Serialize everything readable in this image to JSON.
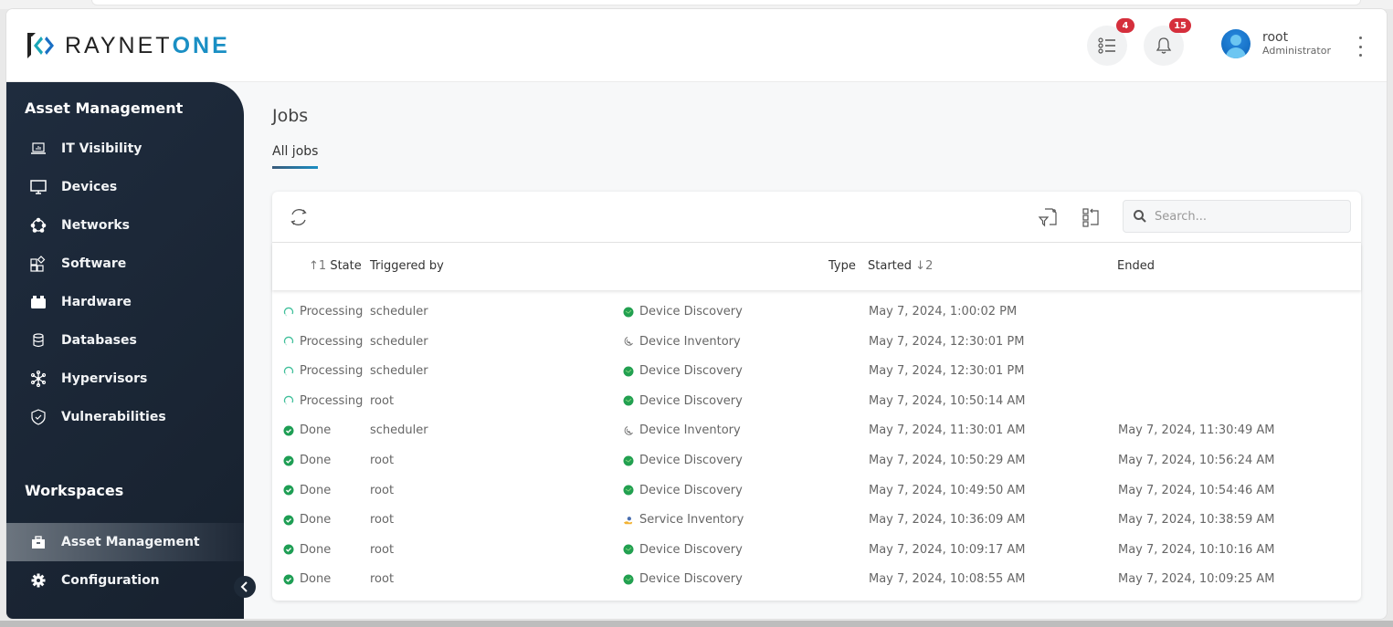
{
  "app": {
    "brand_left": "RAYNET",
    "brand_right": "ONE"
  },
  "header": {
    "tasks_badge": "4",
    "notifications_badge": "15",
    "user_name": "root",
    "user_role": "Administrator"
  },
  "sidebar": {
    "section_title": "Asset Management",
    "items": [
      {
        "label": "IT Visibility",
        "icon": "laptop-chart-icon"
      },
      {
        "label": "Devices",
        "icon": "monitor-icon"
      },
      {
        "label": "Networks",
        "icon": "network-icon"
      },
      {
        "label": "Software",
        "icon": "apps-icon"
      },
      {
        "label": "Hardware",
        "icon": "hardware-icon"
      },
      {
        "label": "Databases",
        "icon": "database-icon"
      },
      {
        "label": "Hypervisors",
        "icon": "hypervisor-icon"
      },
      {
        "label": "Vulnerabilities",
        "icon": "shield-check-icon"
      }
    ],
    "workspaces_title": "Workspaces",
    "workspaces": [
      {
        "label": "Asset Management",
        "icon": "briefcase-icon",
        "active": true
      },
      {
        "label": "Configuration",
        "icon": "gear-icon",
        "active": false
      }
    ]
  },
  "page": {
    "title": "Jobs",
    "tab_label": "All jobs"
  },
  "toolbar": {
    "search_placeholder": "Search..."
  },
  "table": {
    "columns": {
      "state_sort": "1",
      "state": "State",
      "triggered_by": "Triggered by",
      "type": "Type",
      "started": "Started",
      "started_sort": "2",
      "ended": "Ended"
    },
    "rows": [
      {
        "state": "Processing",
        "triggered_by": "scheduler",
        "type": "Device Discovery",
        "started": "May 7, 2024, 1:00:02 PM",
        "ended": ""
      },
      {
        "state": "Processing",
        "triggered_by": "scheduler",
        "type": "Device Inventory",
        "started": "May 7, 2024, 12:30:01 PM",
        "ended": ""
      },
      {
        "state": "Processing",
        "triggered_by": "scheduler",
        "type": "Device Discovery",
        "started": "May 7, 2024, 12:30:01 PM",
        "ended": ""
      },
      {
        "state": "Processing",
        "triggered_by": "root",
        "type": "Device Discovery",
        "started": "May 7, 2024, 10:50:14 AM",
        "ended": ""
      },
      {
        "state": "Done",
        "triggered_by": "scheduler",
        "type": "Device Inventory",
        "started": "May 7, 2024, 11:30:01 AM",
        "ended": "May 7, 2024, 11:30:49 AM"
      },
      {
        "state": "Done",
        "triggered_by": "root",
        "type": "Device Discovery",
        "started": "May 7, 2024, 10:50:29 AM",
        "ended": "May 7, 2024, 10:56:24 AM"
      },
      {
        "state": "Done",
        "triggered_by": "root",
        "type": "Device Discovery",
        "started": "May 7, 2024, 10:49:50 AM",
        "ended": "May 7, 2024, 10:54:46 AM"
      },
      {
        "state": "Done",
        "triggered_by": "root",
        "type": "Service Inventory",
        "started": "May 7, 2024, 10:36:09 AM",
        "ended": "May 7, 2024, 10:38:59 AM"
      },
      {
        "state": "Done",
        "triggered_by": "root",
        "type": "Device Discovery",
        "started": "May 7, 2024, 10:09:17 AM",
        "ended": "May 7, 2024, 10:10:16 AM"
      },
      {
        "state": "Done",
        "triggered_by": "root",
        "type": "Device Discovery",
        "started": "May 7, 2024, 10:08:55 AM",
        "ended": "May 7, 2024, 10:09:25 AM"
      }
    ]
  },
  "colors": {
    "accent": "#1a8fc4",
    "sidebar_bg": "#1f2c3e",
    "badge": "#d52f3c",
    "done_green": "#1e9e54",
    "processing_teal": "#3fbf9a"
  }
}
